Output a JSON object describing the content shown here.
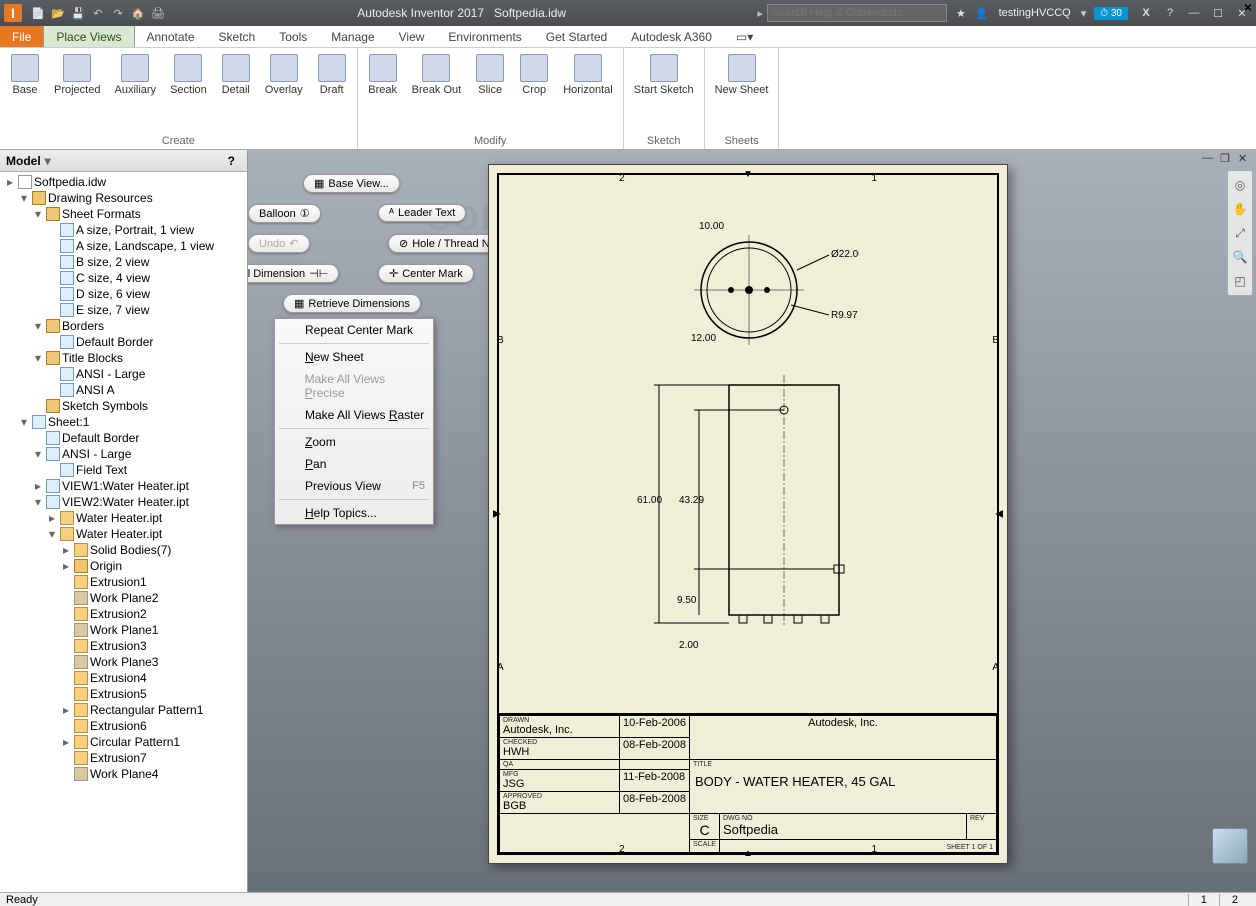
{
  "titlebar": {
    "app": "Autodesk Inventor 2017",
    "document": "Softpedia.idw",
    "search_placeholder": "Search Help & Commands...",
    "user": "testingHVCCQ",
    "badge": "30"
  },
  "tabs": [
    "File",
    "Place Views",
    "Annotate",
    "Sketch",
    "Tools",
    "Manage",
    "View",
    "Environments",
    "Get Started",
    "Autodesk A360"
  ],
  "active_tab": "Place Views",
  "ribbon": {
    "create": {
      "label": "Create",
      "items": [
        "Base",
        "Projected",
        "Auxiliary",
        "Section",
        "Detail",
        "Overlay",
        "Draft"
      ]
    },
    "modify": {
      "label": "Modify",
      "items": [
        "Break",
        "Break Out",
        "Slice",
        "Crop",
        "Horizontal"
      ]
    },
    "sketch": {
      "label": "Sketch",
      "items": [
        "Start Sketch"
      ]
    },
    "sheets": {
      "label": "Sheets",
      "items": [
        "New Sheet"
      ]
    }
  },
  "model_panel": {
    "title": "Model"
  },
  "tree": [
    {
      "d": 0,
      "t": "▸",
      "i": "ic-doc",
      "l": "Softpedia.idw"
    },
    {
      "d": 1,
      "t": "▾",
      "i": "ic-folder",
      "l": "Drawing Resources"
    },
    {
      "d": 2,
      "t": "▾",
      "i": "ic-folder",
      "l": "Sheet Formats"
    },
    {
      "d": 3,
      "t": "",
      "i": "ic-file",
      "l": "A size, Portrait, 1 view"
    },
    {
      "d": 3,
      "t": "",
      "i": "ic-file",
      "l": "A size, Landscape, 1 view"
    },
    {
      "d": 3,
      "t": "",
      "i": "ic-file",
      "l": "B size, 2 view"
    },
    {
      "d": 3,
      "t": "",
      "i": "ic-file",
      "l": "C size, 4 view"
    },
    {
      "d": 3,
      "t": "",
      "i": "ic-file",
      "l": "D size, 6 view"
    },
    {
      "d": 3,
      "t": "",
      "i": "ic-file",
      "l": "E size, 7 view"
    },
    {
      "d": 2,
      "t": "▾",
      "i": "ic-folder",
      "l": "Borders"
    },
    {
      "d": 3,
      "t": "",
      "i": "ic-file",
      "l": "Default Border"
    },
    {
      "d": 2,
      "t": "▾",
      "i": "ic-folder",
      "l": "Title Blocks"
    },
    {
      "d": 3,
      "t": "",
      "i": "ic-file",
      "l": "ANSI - Large"
    },
    {
      "d": 3,
      "t": "",
      "i": "ic-file",
      "l": "ANSI A"
    },
    {
      "d": 2,
      "t": "",
      "i": "ic-folder",
      "l": "Sketch Symbols"
    },
    {
      "d": 1,
      "t": "▾",
      "i": "ic-file",
      "l": "Sheet:1"
    },
    {
      "d": 2,
      "t": "",
      "i": "ic-file",
      "l": "Default Border"
    },
    {
      "d": 2,
      "t": "▾",
      "i": "ic-file",
      "l": "ANSI - Large"
    },
    {
      "d": 3,
      "t": "",
      "i": "ic-file",
      "l": "Field Text"
    },
    {
      "d": 2,
      "t": "▸",
      "i": "ic-file",
      "l": "VIEW1:Water Heater.ipt"
    },
    {
      "d": 2,
      "t": "▾",
      "i": "ic-file",
      "l": "VIEW2:Water Heater.ipt"
    },
    {
      "d": 3,
      "t": "▸",
      "i": "ic-feat",
      "l": "Water Heater.ipt"
    },
    {
      "d": 3,
      "t": "▾",
      "i": "ic-feat",
      "l": "Water Heater.ipt"
    },
    {
      "d": 4,
      "t": "▸",
      "i": "ic-feat",
      "l": "Solid Bodies(7)"
    },
    {
      "d": 4,
      "t": "▸",
      "i": "ic-folder",
      "l": "Origin"
    },
    {
      "d": 4,
      "t": "",
      "i": "ic-feat",
      "l": "Extrusion1"
    },
    {
      "d": 4,
      "t": "",
      "i": "ic-plane",
      "l": "Work Plane2"
    },
    {
      "d": 4,
      "t": "",
      "i": "ic-feat",
      "l": "Extrusion2"
    },
    {
      "d": 4,
      "t": "",
      "i": "ic-plane",
      "l": "Work Plane1"
    },
    {
      "d": 4,
      "t": "",
      "i": "ic-feat",
      "l": "Extrusion3"
    },
    {
      "d": 4,
      "t": "",
      "i": "ic-plane",
      "l": "Work Plane3"
    },
    {
      "d": 4,
      "t": "",
      "i": "ic-feat",
      "l": "Extrusion4"
    },
    {
      "d": 4,
      "t": "",
      "i": "ic-feat",
      "l": "Extrusion5"
    },
    {
      "d": 4,
      "t": "▸",
      "i": "ic-feat",
      "l": "Rectangular Pattern1"
    },
    {
      "d": 4,
      "t": "",
      "i": "ic-feat",
      "l": "Extrusion6"
    },
    {
      "d": 4,
      "t": "▸",
      "i": "ic-feat",
      "l": "Circular Pattern1"
    },
    {
      "d": 4,
      "t": "",
      "i": "ic-feat",
      "l": "Extrusion7"
    },
    {
      "d": 4,
      "t": "",
      "i": "ic-plane",
      "l": "Work Plane4"
    }
  ],
  "floating": {
    "base_view": "Base View...",
    "balloon": "Balloon",
    "leader_text": "Leader Text",
    "undo": "Undo",
    "hole_thread": "Hole / Thread Notes",
    "general_dim": "General Dimension",
    "center_mark": "Center Mark",
    "retrieve": "Retrieve Dimensions"
  },
  "context_menu": [
    {
      "l": "Repeat Center Mark",
      "d": false
    },
    {
      "sep": true
    },
    {
      "l": "New Sheet",
      "u": "N",
      "d": false
    },
    {
      "l": "Make All Views Precise",
      "u": "P",
      "d": true
    },
    {
      "l": "Make All Views Raster",
      "u": "R",
      "d": false
    },
    {
      "sep": true
    },
    {
      "l": "Zoom",
      "u": "Z",
      "d": false
    },
    {
      "l": "Pan",
      "u": "P",
      "d": false
    },
    {
      "l": "Previous View",
      "sc": "F5",
      "d": false
    },
    {
      "sep": true
    },
    {
      "l": "Help Topics...",
      "u": "H",
      "d": false
    }
  ],
  "drawing": {
    "dims": {
      "d1": "10.00",
      "d2": "Ø22.00",
      "d3": "R9.97",
      "d4": "12.00",
      "d5": "61.00",
      "d6": "43.29",
      "d7": "9.50",
      "d8": "2.00"
    },
    "zones_top": [
      "2",
      "1"
    ],
    "zones_side": [
      "B",
      "A"
    ],
    "titleblock": {
      "drawn": {
        "lbl": "DRAWN",
        "by": "Autodesk, Inc.",
        "date": "10-Feb-2006"
      },
      "checked": {
        "lbl": "CHECKED",
        "by": "HWH",
        "date": "08-Feb-2008"
      },
      "qa": {
        "lbl": "QA"
      },
      "mfg": {
        "lbl": "MFG",
        "by": "JSG",
        "date": "11-Feb-2008"
      },
      "approved": {
        "lbl": "APPROVED",
        "by": "BGB",
        "date": "08-Feb-2008"
      },
      "company": "Autodesk, Inc.",
      "title_lbl": "TITLE",
      "title": "BODY - WATER HEATER, 45 GAL",
      "size_lbl": "SIZE",
      "size": "C",
      "dwg_lbl": "DWG NO",
      "dwg": "Softpedia",
      "rev_lbl": "REV",
      "scale_lbl": "SCALE",
      "sheet": "SHEET 1  OF 1"
    }
  },
  "status": {
    "ready": "Ready",
    "p1": "1",
    "p2": "2"
  },
  "watermark": "SOFTPEDIA"
}
